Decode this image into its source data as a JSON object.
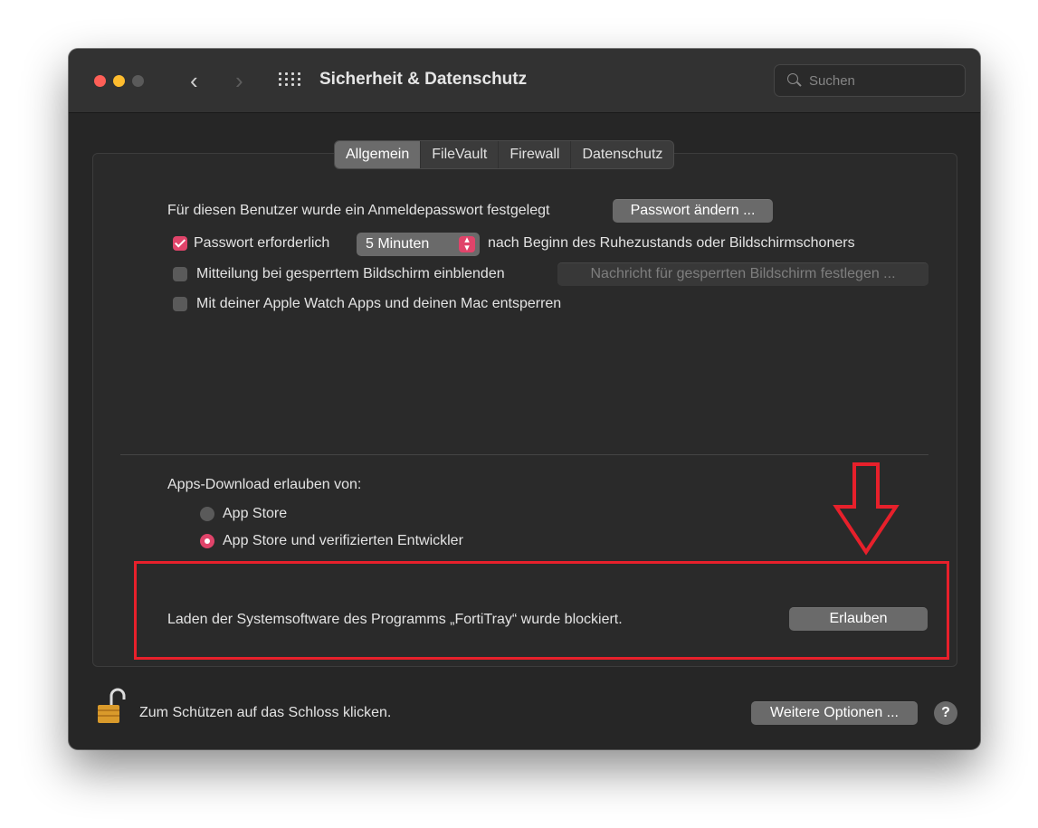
{
  "window": {
    "title": "Sicherheit & Datenschutz",
    "search_placeholder": "Suchen",
    "nav_back": "‹",
    "nav_forward": "›"
  },
  "tabs": [
    {
      "label": "Allgemein",
      "active": true
    },
    {
      "label": "FileVault",
      "active": false
    },
    {
      "label": "Firewall",
      "active": false
    },
    {
      "label": "Datenschutz",
      "active": false
    }
  ],
  "general": {
    "password_set_text": "Für diesen Benutzer wurde ein Anmeldepasswort festgelegt",
    "change_password_button": "Passwort ändern ...",
    "require_password": {
      "label": "Passwort erforderlich",
      "checked": true,
      "delay_value": "5 Minuten",
      "suffix": "nach Beginn des Ruhezustands oder Bildschirmschoners"
    },
    "lock_message": {
      "label": "Mitteilung bei gesperrtem Bildschirm einblenden",
      "checked": false,
      "button": "Nachricht für gesperrten Bildschirm festlegen ..."
    },
    "apple_watch": {
      "label": "Mit deiner Apple Watch Apps und deinen Mac entsperren",
      "checked": false
    }
  },
  "downloads": {
    "heading": "Apps-Download erlauben von:",
    "options": [
      {
        "label": "App Store",
        "selected": false
      },
      {
        "label": "App Store und verifizierten Entwickler",
        "selected": true
      }
    ]
  },
  "blocked": {
    "message": "Laden der Systemsoftware des Programms „FortiTray“ wurde blockiert.",
    "allow_button": "Erlauben"
  },
  "footer": {
    "lock_text": "Zum Schützen auf das Schloss klicken.",
    "more_options_button": "Weitere Optionen ...",
    "help_label": "?"
  },
  "colors": {
    "accent": "#e0446a",
    "annotation_red": "#e7202b"
  },
  "icons": [
    "search-icon",
    "grid-icon",
    "lock-open-icon",
    "arrow-down-icon"
  ]
}
